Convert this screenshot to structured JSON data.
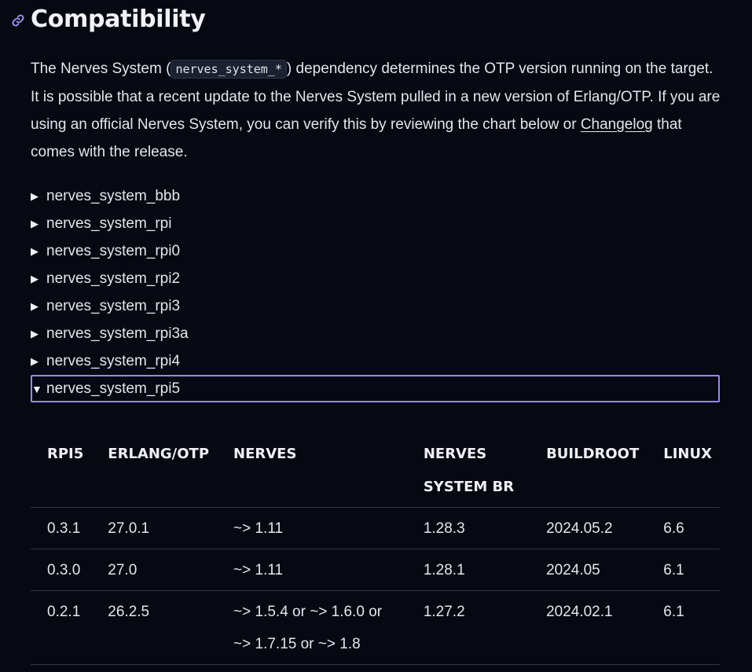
{
  "heading": {
    "icon": "link-icon",
    "title": "Compatibility"
  },
  "intro": {
    "part1": "The Nerves System (",
    "code": "nerves_system_*",
    "part2": ") dependency determines the OTP version running on the target. It is possible that a recent update to the Nerves System pulled in a new version of Erlang/OTP. If you are using an official Nerves System, you can verify this by reviewing the chart below or ",
    "link": "Changelog",
    "part3": " that comes with the release."
  },
  "systems": [
    {
      "label": "nerves_system_bbb",
      "marker": "▶",
      "open": false
    },
    {
      "label": "nerves_system_rpi",
      "marker": "▶",
      "open": false
    },
    {
      "label": "nerves_system_rpi0",
      "marker": "▶",
      "open": false
    },
    {
      "label": "nerves_system_rpi2",
      "marker": "▶",
      "open": false
    },
    {
      "label": "nerves_system_rpi3",
      "marker": "▶",
      "open": false
    },
    {
      "label": "nerves_system_rpi3a",
      "marker": "▶",
      "open": false
    },
    {
      "label": "nerves_system_rpi4",
      "marker": "▶",
      "open": false
    },
    {
      "label": "nerves_system_rpi5",
      "marker": "▼",
      "open": true
    }
  ],
  "table": {
    "headers": [
      "RPI5",
      "ERLANG/OTP",
      "NERVES",
      "NERVES SYSTEM BR",
      "BUILDROOT",
      "LINUX"
    ],
    "rows": [
      [
        "0.3.1",
        "27.0.1",
        "~> 1.11",
        "1.28.3",
        "2024.05.2",
        "6.6"
      ],
      [
        "0.3.0",
        "27.0",
        "~> 1.11",
        "1.28.1",
        "2024.05",
        "6.1"
      ],
      [
        "0.2.1",
        "26.2.5",
        "~> 1.5.4 or ~> 1.6.0 or ~> 1.7.15 or ~> 1.8",
        "1.27.2",
        "2024.02.1",
        "6.1"
      ]
    ]
  },
  "colors": {
    "background": "#060912",
    "accent": "#9b87ea",
    "text": "#e3e6ee"
  }
}
